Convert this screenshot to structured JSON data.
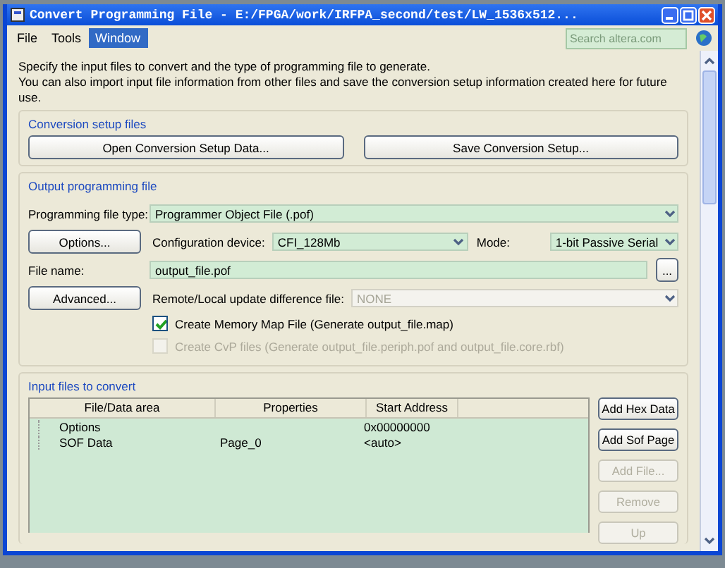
{
  "window": {
    "title": "Convert Programming File - E:/FPGA/work/IRFPA_second/test/LW_1536x512..."
  },
  "menu": [
    {
      "label": "File",
      "selected": false
    },
    {
      "label": "Tools",
      "selected": false
    },
    {
      "label": "Window",
      "selected": true
    }
  ],
  "search": {
    "placeholder": "Search altera.com"
  },
  "intro": "Specify the input files to convert and the type of programming file to generate.\nYou can also import input file information from other files and save the conversion setup information created here for future use.",
  "setup_group": {
    "title": "Conversion setup files",
    "buttons": [
      "Open Conversion Setup Data...",
      "Save Conversion Setup..."
    ]
  },
  "output_group": {
    "title": "Output programming file",
    "file_type": {
      "label": "Programming file type:",
      "value": "Programmer Object File (.pof)"
    },
    "options_button": "Options...",
    "config_device": {
      "label": "Configuration device:",
      "value": "CFI_128Mb"
    },
    "mode": {
      "label": "Mode:",
      "value": "1-bit Passive Serial"
    },
    "file_name": {
      "label": "File name:",
      "value": "output_file.pof",
      "browse": "..."
    },
    "advanced_button": "Advanced...",
    "remote_diff": {
      "label": "Remote/Local update difference file:",
      "value": "NONE",
      "disabled": true
    },
    "checkboxes": [
      {
        "label": "Create Memory Map File (Generate output_file.map)",
        "checked": true,
        "disabled": false
      },
      {
        "label": "Create CvP files (Generate output_file.periph.pof and output_file.core.rbf)",
        "checked": false,
        "disabled": true
      }
    ]
  },
  "input_group": {
    "title": "Input files to convert",
    "table": {
      "columns": [
        "File/Data area",
        "Properties",
        "Start Address"
      ],
      "rows": [
        [
          "Options",
          "",
          "0x00000000"
        ],
        [
          "SOF Data",
          "Page_0",
          "<auto>"
        ]
      ]
    },
    "buttons": [
      {
        "label": "Add Hex Data",
        "disabled": false
      },
      {
        "label": "Add Sof Page",
        "disabled": false
      },
      {
        "label": "Add File...",
        "disabled": true
      },
      {
        "label": "Remove",
        "disabled": true
      },
      {
        "label": "Up",
        "disabled": true
      }
    ]
  }
}
